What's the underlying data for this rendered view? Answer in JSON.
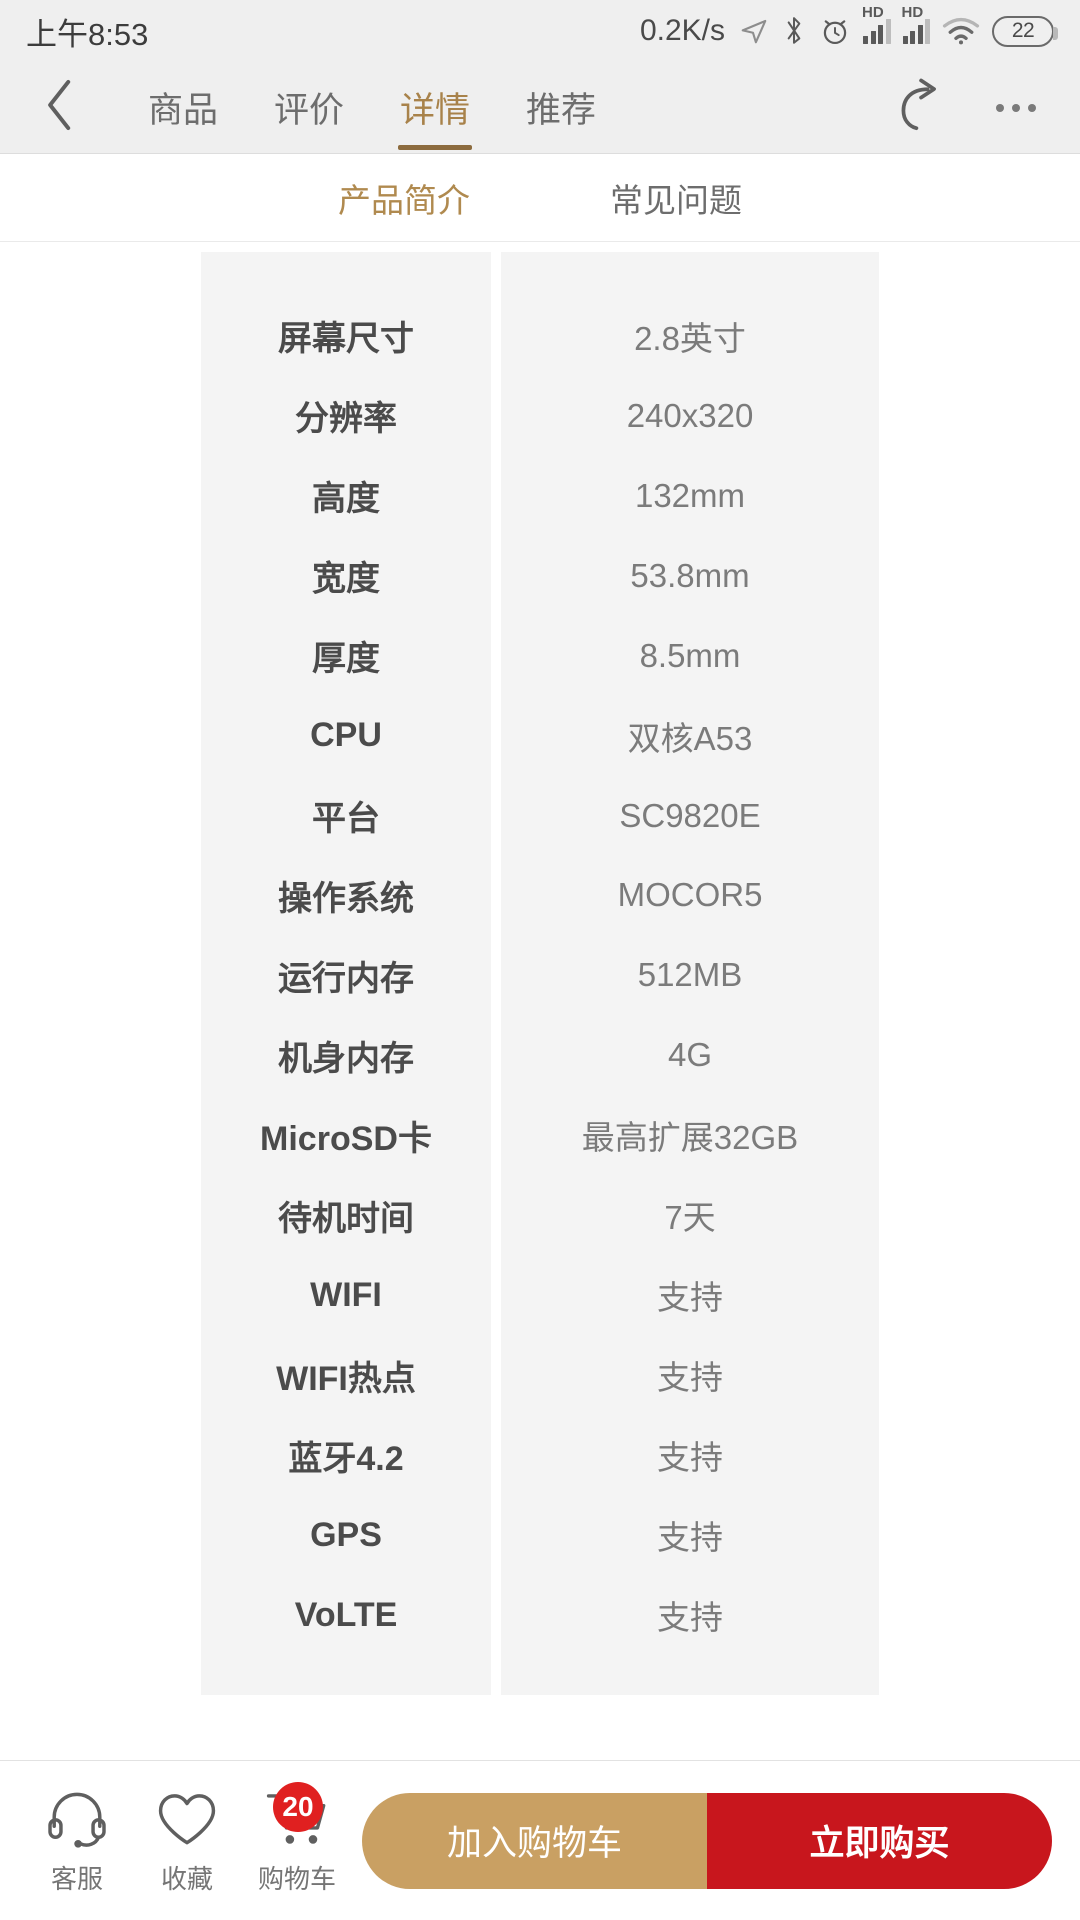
{
  "statusbar": {
    "time": "上午8:53",
    "network_speed": "0.2K/s",
    "hd_label_1": "HD",
    "hd_label_2": "HD",
    "battery_level": "22",
    "icons": [
      "location-arrow-icon",
      "bluetooth-icon",
      "alarm-clock-icon",
      "signal-hd-1-icon",
      "signal-hd-2-icon",
      "wifi-icon",
      "battery-icon"
    ]
  },
  "navbar": {
    "back_icon": "back-chevron-icon",
    "tabs": [
      {
        "label": "商品",
        "active": false
      },
      {
        "label": "评价",
        "active": false
      },
      {
        "label": "详情",
        "active": true
      },
      {
        "label": "推荐",
        "active": false
      }
    ],
    "share_icon": "share-icon",
    "more_icon": "more-dots-icon",
    "active_color": "#a8824a",
    "underline_color": "#8c6b3e"
  },
  "subtabs": [
    {
      "label": "产品简介",
      "active": true
    },
    {
      "label": "常见问题",
      "active": false
    }
  ],
  "spec_table": {
    "rows": [
      {
        "label": "屏幕尺寸",
        "value": "2.8英寸"
      },
      {
        "label": "分辨率",
        "value": "240x320"
      },
      {
        "label": "高度",
        "value": "132mm"
      },
      {
        "label": "宽度",
        "value": "53.8mm"
      },
      {
        "label": "厚度",
        "value": "8.5mm"
      },
      {
        "label": "CPU",
        "value": "双核A53"
      },
      {
        "label": "平台",
        "value": "SC9820E"
      },
      {
        "label": "操作系统",
        "value": "MOCOR5"
      },
      {
        "label": "运行内存",
        "value": "512MB"
      },
      {
        "label": "机身内存",
        "value": "4G"
      },
      {
        "label": "MicroSD卡",
        "value": "最高扩展32GB"
      },
      {
        "label": "待机时间",
        "value": "7天"
      },
      {
        "label": "WIFI",
        "value": "支持"
      },
      {
        "label": "WIFI热点",
        "value": "支持"
      },
      {
        "label": "蓝牙4.2",
        "value": "支持"
      },
      {
        "label": "GPS",
        "value": "支持"
      },
      {
        "label": "VoLTE",
        "value": "支持"
      }
    ]
  },
  "bottombar": {
    "items": [
      {
        "label": "客服",
        "icon": "headset-icon",
        "badge": null
      },
      {
        "label": "收藏",
        "icon": "heart-icon",
        "badge": null
      },
      {
        "label": "购物车",
        "icon": "cart-icon",
        "badge": "20"
      }
    ],
    "add_to_cart_label": "加入购物车",
    "buy_now_label": "立即购买",
    "add_to_cart_color": "#c9a063",
    "buy_now_color": "#c8161d",
    "badge_color": "#e02020"
  }
}
